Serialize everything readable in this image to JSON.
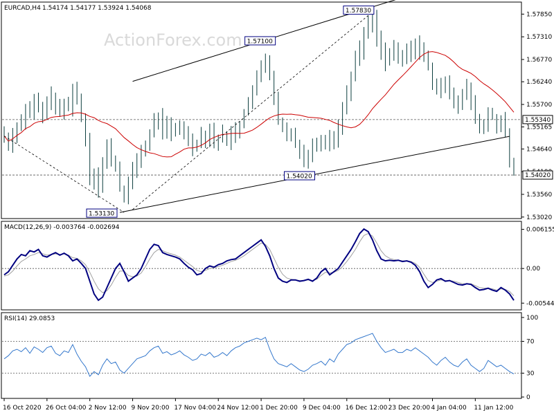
{
  "header": {
    "symbol": "EURCAD,H4",
    "ohlc": "1.54174 1.54177 1.53924 1.54068",
    "watermark": "ActionForex.com"
  },
  "colors": {
    "candles": "#0b3d3d",
    "ma": "#cc0000",
    "macd": "#000080",
    "signal": "#a0a0a0",
    "rsi": "#3377cc",
    "trend": "#000000",
    "grid_dash": "#555555"
  },
  "chart_data": [
    {
      "type": "candlestick",
      "title": "EURCAD,H4",
      "ylim": [
        1.53,
        1.5812
      ],
      "yticks": [
        "1.57850",
        "1.57310",
        "1.56770",
        "1.56240",
        "1.55700",
        "1.55165",
        "1.54640",
        "1.54100",
        "1.53560",
        "1.53020"
      ],
      "ytick_values": [
        1.5785,
        1.5731,
        1.5677,
        1.5624,
        1.557,
        1.55165,
        1.5464,
        1.541,
        1.5356,
        1.5302
      ],
      "hlines": [
        {
          "value": 1.5534,
          "label": "1.55340"
        },
        {
          "value": 1.5402,
          "label": "1.54020"
        }
      ],
      "annotations": [
        {
          "label": "1.57830",
          "value": 1.5783,
          "x": 86
        },
        {
          "label": "1.57100",
          "value": 1.571,
          "x": 63
        },
        {
          "label": "1.54020",
          "value": 1.5402,
          "x": 73
        },
        {
          "label": "1.53130",
          "value": 1.5313,
          "x": 27
        }
      ],
      "trend_lines": [
        {
          "name": "upper-channel",
          "style": "solid",
          "from": [
            30,
            1.5625
          ],
          "to": [
            97,
            1.5837
          ]
        },
        {
          "name": "lower-channel",
          "style": "solid",
          "from": [
            27,
            1.5313
          ],
          "to": [
            118,
            1.5494
          ]
        },
        {
          "name": "up-dashed",
          "style": "dashed",
          "from": [
            30,
            1.532
          ],
          "to": [
            86,
            1.579
          ]
        },
        {
          "name": "down-dashed",
          "style": "dashed",
          "from": [
            0,
            1.5495
          ],
          "to": [
            28,
            1.5313
          ]
        }
      ],
      "x_labels": [
        "16 Oct 2020",
        "26 Oct 04:00",
        "2 Nov 12:00",
        "9 Nov 20:00",
        "17 Nov 04:00",
        "24 Nov 12:00",
        "1 Dec 20:00",
        "9 Dec 04:00",
        "16 Dec 12:00",
        "23 Dec 20:00",
        "4 Jan 04:00",
        "11 Jan 12:00"
      ],
      "x_label_index": [
        0,
        10,
        20,
        30,
        40,
        50,
        60,
        70,
        80,
        90,
        100,
        110
      ],
      "candle_count": 120,
      "close": [
        1.5495,
        1.547,
        1.55,
        1.552,
        1.553,
        1.556,
        1.5545,
        1.558,
        1.556,
        1.554,
        1.558,
        1.559,
        1.556,
        1.555,
        1.557,
        1.5565,
        1.561,
        1.558,
        1.554,
        1.549,
        1.539,
        1.541,
        1.537,
        1.543,
        1.547,
        1.544,
        1.542,
        1.537,
        1.535,
        1.538,
        1.541,
        1.544,
        1.546,
        1.547,
        1.55,
        1.553,
        1.554,
        1.551,
        1.552,
        1.55,
        1.551,
        1.552,
        1.55,
        1.549,
        1.547,
        1.548,
        1.55,
        1.549,
        1.551,
        1.548,
        1.549,
        1.55,
        1.548,
        1.55,
        1.551,
        1.552,
        1.555,
        1.558,
        1.56,
        1.563,
        1.566,
        1.568,
        1.564,
        1.558,
        1.553,
        1.551,
        1.549,
        1.55,
        1.548,
        1.546,
        1.544,
        1.545,
        1.547,
        1.548,
        1.549,
        1.547,
        1.55,
        1.548,
        1.552,
        1.556,
        1.56,
        1.564,
        1.568,
        1.57,
        1.574,
        1.576,
        1.5775,
        1.573,
        1.57,
        1.567,
        1.569,
        1.57,
        1.568,
        1.568,
        1.57,
        1.569,
        1.572,
        1.57,
        1.568,
        1.566,
        1.562,
        1.56,
        1.561,
        1.563,
        1.56,
        1.558,
        1.557,
        1.559,
        1.561,
        1.557,
        1.554,
        1.551,
        1.552,
        1.555,
        1.554,
        1.552,
        1.553,
        1.55,
        1.543,
        1.5407
      ],
      "ma_period": 20
    },
    {
      "type": "line",
      "title": "MACD(12,26,9) -0.003764 -0.002694",
      "ylim": [
        -0.0064,
        0.0072
      ],
      "yticks": [
        "0.006155",
        "0.00",
        "-0.005449"
      ],
      "ytick_values": [
        0.006155,
        0.0,
        -0.005449
      ],
      "series": [
        {
          "name": "MACD",
          "values": [
            -0.001,
            -0.0005,
            0.0005,
            0.0015,
            0.0022,
            0.002,
            0.0028,
            0.0026,
            0.003,
            0.002,
            0.0018,
            0.0022,
            0.0025,
            0.0021,
            0.0024,
            0.002,
            0.0012,
            0.0015,
            0.0008,
            0.0,
            -0.002,
            -0.004,
            -0.005,
            -0.0045,
            -0.003,
            -0.0015,
            0.0,
            0.0008,
            -0.0005,
            -0.002,
            -0.0015,
            -0.001,
            0.0,
            0.0015,
            0.003,
            0.0038,
            0.0036,
            0.0025,
            0.0022,
            0.002,
            0.0018,
            0.0015,
            0.0008,
            0.0002,
            -0.0002,
            -0.001,
            -0.0008,
            0.0,
            0.0004,
            0.0002,
            0.0006,
            0.0008,
            0.0012,
            0.0014,
            0.0015,
            0.002,
            0.0025,
            0.003,
            0.0035,
            0.004,
            0.0045,
            0.0035,
            0.002,
            0.0,
            -0.0015,
            -0.002,
            -0.0022,
            -0.0018,
            -0.0018,
            -0.002,
            -0.0019,
            -0.0017,
            -0.002,
            -0.0015,
            -0.0005,
            0.0,
            -0.001,
            -0.0005,
            0.0,
            0.001,
            0.002,
            0.003,
            0.0042,
            0.0055,
            0.0062,
            0.0058,
            0.0045,
            0.0028,
            0.0015,
            0.0012,
            0.0013,
            0.0012,
            0.0013,
            0.0011,
            0.0012,
            0.001,
            0.0005,
            -0.0005,
            -0.002,
            -0.003,
            -0.0025,
            -0.0018,
            -0.0016,
            -0.002,
            -0.0019,
            -0.0022,
            -0.0025,
            -0.0026,
            -0.0024,
            -0.0025,
            -0.003,
            -0.0034,
            -0.0033,
            -0.0031,
            -0.0034,
            -0.0036,
            -0.003,
            -0.0034,
            -0.004,
            -0.005
          ]
        },
        {
          "name": "Signal",
          "values": [
            -0.0012,
            -0.001,
            -0.0004,
            0.0004,
            0.0011,
            0.0015,
            0.002,
            0.0022,
            0.0025,
            0.0023,
            0.0021,
            0.0022,
            0.0023,
            0.0022,
            0.0023,
            0.0021,
            0.0017,
            0.0016,
            0.0012,
            0.0006,
            -0.0006,
            -0.002,
            -0.0032,
            -0.0038,
            -0.0035,
            -0.0026,
            -0.0014,
            -0.0004,
            -0.0004,
            -0.0011,
            -0.0013,
            -0.0012,
            -0.0007,
            0.0003,
            0.0015,
            0.0025,
            0.003,
            0.0028,
            0.0025,
            0.0023,
            0.0021,
            0.0018,
            0.0013,
            0.0008,
            0.0003,
            -0.0003,
            -0.0005,
            -0.0003,
            0.0,
            0.0001,
            0.0003,
            0.0005,
            0.0008,
            0.0011,
            0.0013,
            0.0016,
            0.002,
            0.0025,
            0.003,
            0.0035,
            0.004,
            0.0038,
            0.003,
            0.0016,
            0.0002,
            -0.0009,
            -0.0015,
            -0.0017,
            -0.0018,
            -0.0019,
            -0.0019,
            -0.0018,
            -0.0019,
            -0.0017,
            -0.0011,
            -0.0006,
            -0.0007,
            -0.0006,
            -0.0003,
            0.0003,
            0.0011,
            0.002,
            0.003,
            0.0042,
            0.0052,
            0.0055,
            0.0051,
            0.004,
            0.0028,
            0.002,
            0.0016,
            0.0014,
            0.0013,
            0.0012,
            0.0012,
            0.0011,
            0.0008,
            0.0002,
            -0.0009,
            -0.0019,
            -0.0022,
            -0.002,
            -0.0018,
            -0.0019,
            -0.0019,
            -0.002,
            -0.0022,
            -0.0024,
            -0.0024,
            -0.0024,
            -0.0027,
            -0.003,
            -0.0031,
            -0.0031,
            -0.0032,
            -0.0034,
            -0.0032,
            -0.0033,
            -0.0036,
            -0.0043
          ]
        }
      ]
    },
    {
      "type": "line",
      "title": "RSI(14) 29.0853",
      "ylim": [
        0,
        100
      ],
      "yticks": [
        "100",
        "70",
        "30",
        "0"
      ],
      "ytick_values": [
        100,
        70,
        30,
        0
      ],
      "hlines": [
        {
          "value": 70
        },
        {
          "value": 30
        }
      ],
      "series": [
        {
          "name": "RSI(14)",
          "values": [
            48,
            52,
            58,
            60,
            57,
            62,
            55,
            63,
            60,
            56,
            62,
            64,
            55,
            52,
            58,
            56,
            66,
            54,
            45,
            38,
            26,
            32,
            28,
            40,
            48,
            42,
            44,
            34,
            30,
            36,
            42,
            48,
            50,
            52,
            58,
            62,
            64,
            55,
            57,
            53,
            55,
            58,
            53,
            50,
            46,
            48,
            54,
            52,
            56,
            50,
            52,
            56,
            52,
            58,
            62,
            64,
            68,
            70,
            72,
            74,
            72,
            75,
            60,
            48,
            42,
            40,
            38,
            42,
            38,
            34,
            32,
            35,
            40,
            42,
            45,
            40,
            48,
            44,
            54,
            60,
            66,
            68,
            72,
            74,
            76,
            78,
            80,
            70,
            62,
            56,
            58,
            60,
            56,
            56,
            60,
            58,
            62,
            58,
            54,
            50,
            44,
            40,
            46,
            50,
            44,
            40,
            38,
            44,
            48,
            40,
            36,
            32,
            36,
            46,
            42,
            38,
            40,
            36,
            32,
            29
          ]
        }
      ]
    }
  ]
}
